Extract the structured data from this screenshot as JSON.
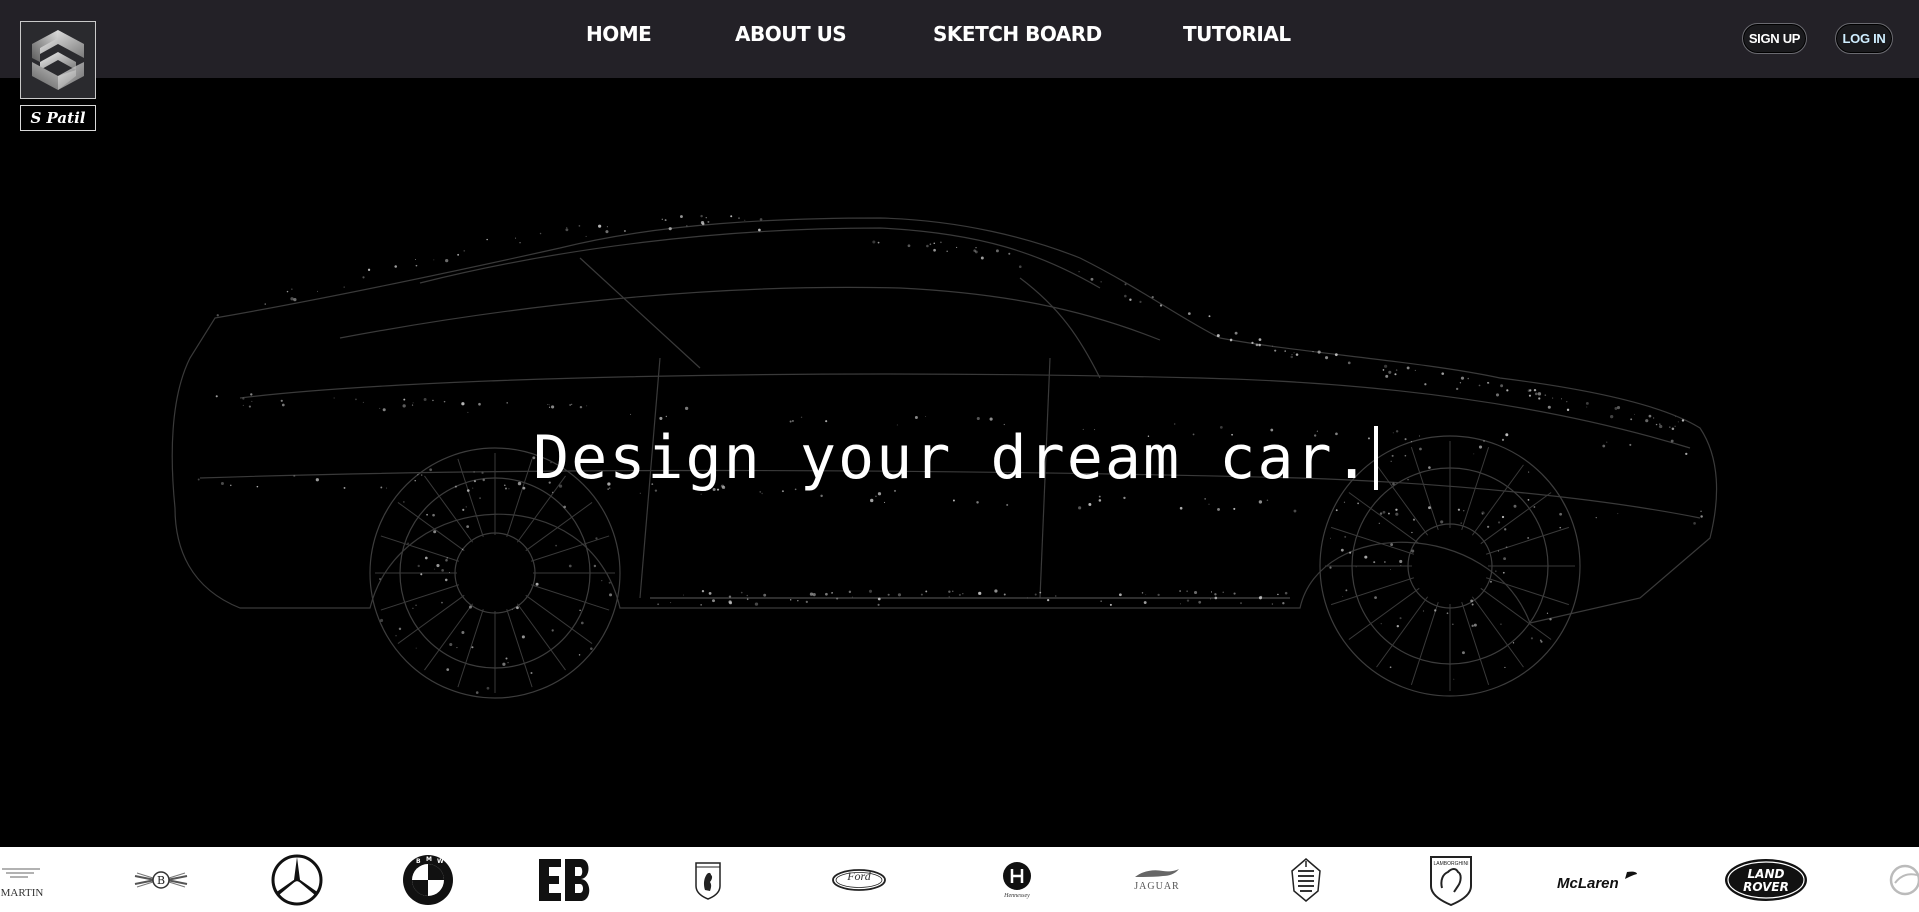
{
  "header": {
    "logo_label": "S Patil",
    "nav": [
      {
        "label": "HOME"
      },
      {
        "label": "ABOUT US"
      },
      {
        "label": "SKETCH BOARD"
      },
      {
        "label": "TUTORIAL"
      }
    ],
    "signup_label": "SIGN UP",
    "login_label": "LOG IN"
  },
  "hero": {
    "headline": "Design your dream car."
  },
  "brands": {
    "items": [
      {
        "name": "aston-martin",
        "text": "MARTIN",
        "icon": "aston-martin-logo"
      },
      {
        "name": "bentley",
        "text": "",
        "icon": "bentley-logo"
      },
      {
        "name": "mercedes",
        "text": "",
        "icon": "mercedes-logo"
      },
      {
        "name": "bmw",
        "text": "",
        "icon": "bmw-logo"
      },
      {
        "name": "bugatti",
        "text": "",
        "icon": "bugatti-logo"
      },
      {
        "name": "ferrari",
        "text": "",
        "icon": "ferrari-logo"
      },
      {
        "name": "ford",
        "text": "Ford",
        "icon": "ford-logo"
      },
      {
        "name": "hennessey",
        "text": "Hennessey",
        "icon": "hennessey-logo"
      },
      {
        "name": "jaguar",
        "text": "JAGUAR",
        "icon": "jaguar-logo"
      },
      {
        "name": "koenigsegg",
        "text": "",
        "icon": "koenigsegg-logo"
      },
      {
        "name": "lamborghini",
        "text": "LAMBORGHINI",
        "icon": "lamborghini-logo"
      },
      {
        "name": "mclaren",
        "text": "McLaren",
        "icon": "mclaren-logo"
      },
      {
        "name": "land-rover",
        "text": "LAND ROVER",
        "icon": "land-rover-logo"
      }
    ]
  },
  "colors": {
    "navbar_bg": "#232127",
    "hero_bg": "#000000",
    "strip_bg": "#ffffff"
  }
}
